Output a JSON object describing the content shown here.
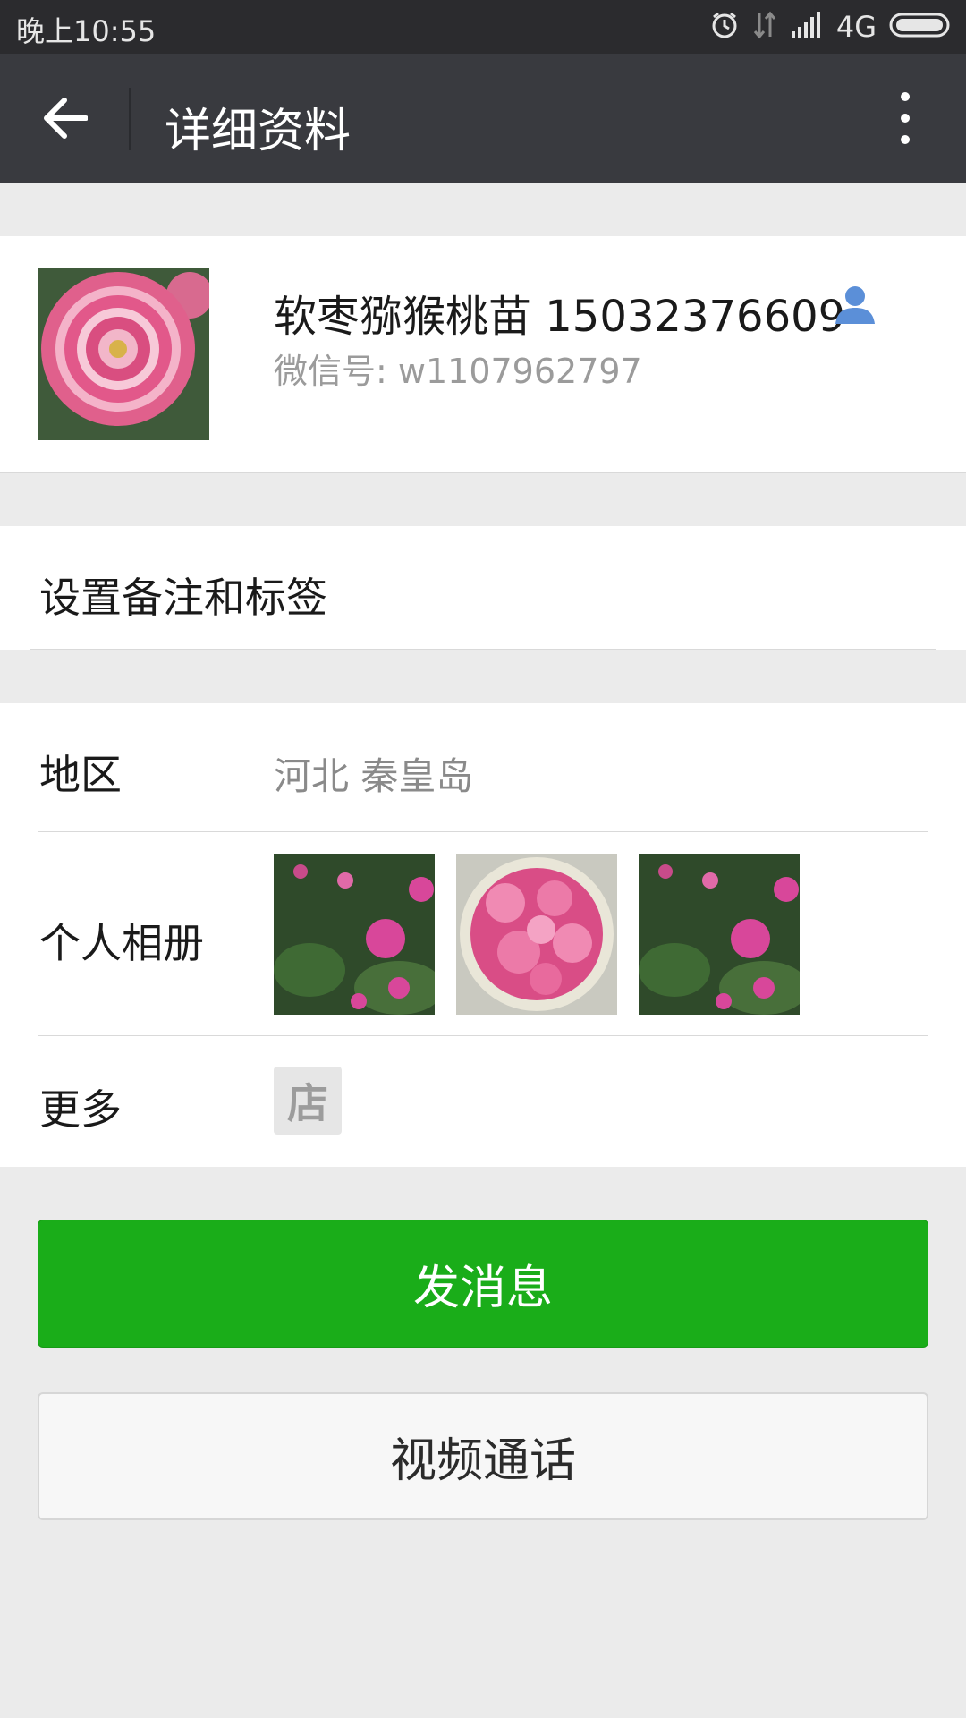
{
  "status_bar": {
    "time": "晚上10:55",
    "network": "4G"
  },
  "title_bar": {
    "title": "详细资料"
  },
  "profile": {
    "name": "软枣猕猴桃苗 15032376609",
    "wechat_id": "微信号: w1107962797"
  },
  "remark": {
    "label": "设置备注和标签"
  },
  "info": {
    "region_label": "地区",
    "region_value": "河北  秦皇岛",
    "album_label": "个人相册",
    "more_label": "更多",
    "shop_icon_text": "店"
  },
  "buttons": {
    "send_message": "发消息",
    "video_call": "视频通话"
  },
  "colors": {
    "accent_green": "#1aad19",
    "titlebar": "#393a3f",
    "statusbar": "#2b2b2e",
    "background": "#ebebeb"
  }
}
